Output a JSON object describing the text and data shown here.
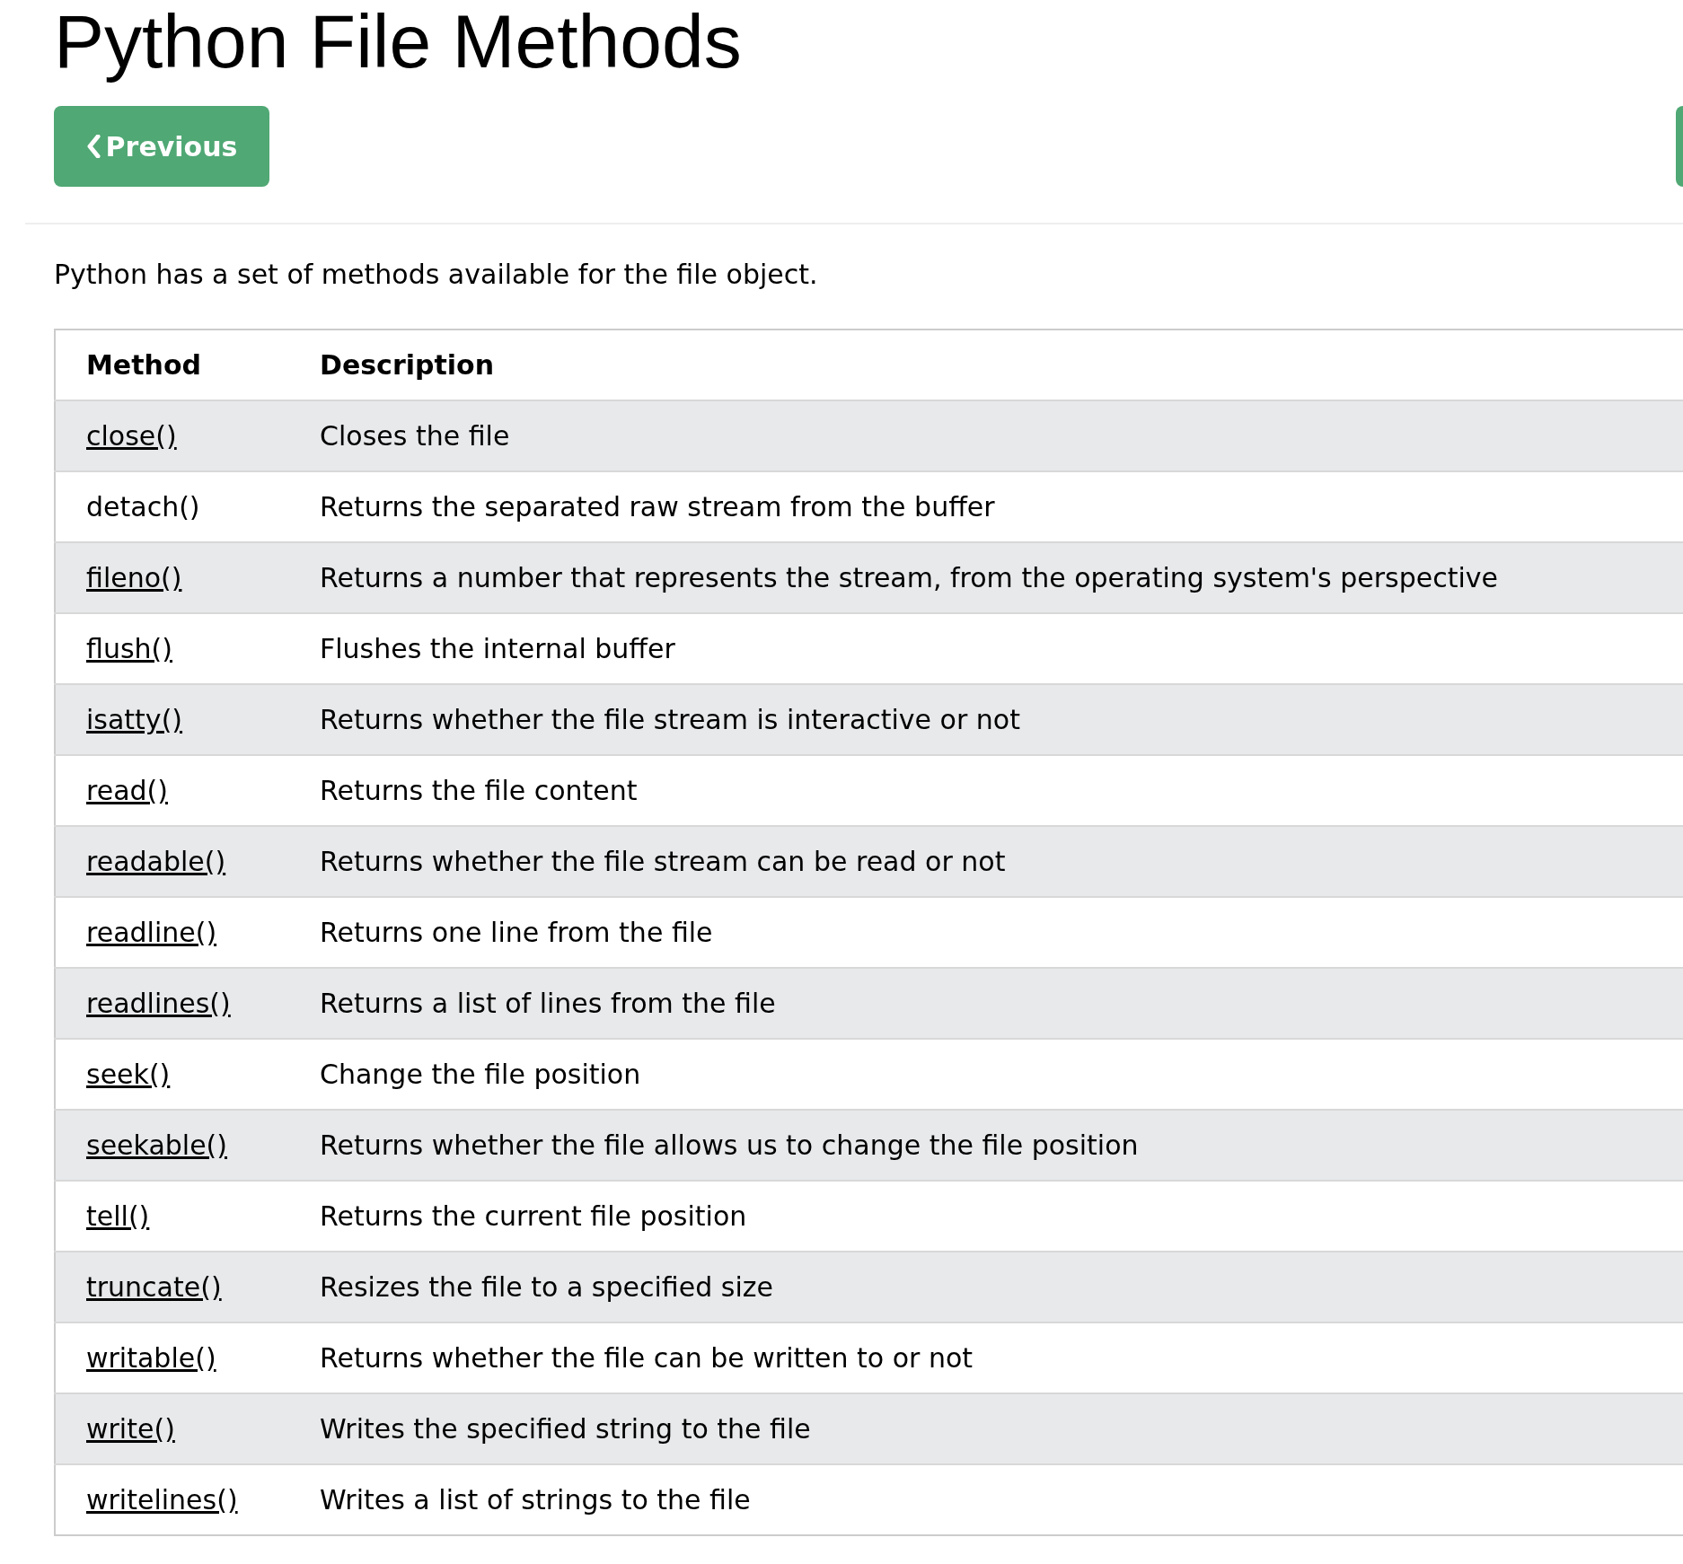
{
  "title": "Python File Methods",
  "nav": {
    "previous": "Previous"
  },
  "intro": "Python has a set of methods available for the file object.",
  "table": {
    "columns": [
      "Method",
      "Description"
    ],
    "rows": [
      {
        "method": "close()",
        "link": true,
        "description": "Closes the file"
      },
      {
        "method": "detach()",
        "link": false,
        "description": "Returns the separated raw stream from the buffer"
      },
      {
        "method": "fileno()",
        "link": true,
        "description": "Returns a number that represents the stream, from the operating system's perspective"
      },
      {
        "method": "flush()",
        "link": true,
        "description": "Flushes the internal buffer"
      },
      {
        "method": "isatty()",
        "link": true,
        "description": "Returns whether the file stream is interactive or not"
      },
      {
        "method": "read()",
        "link": true,
        "description": "Returns the file content"
      },
      {
        "method": "readable()",
        "link": true,
        "description": "Returns whether the file stream can be read or not"
      },
      {
        "method": "readline()",
        "link": true,
        "description": "Returns one line from the file"
      },
      {
        "method": "readlines()",
        "link": true,
        "description": "Returns a list of lines from the file"
      },
      {
        "method": "seek()",
        "link": true,
        "description": "Change the file position"
      },
      {
        "method": "seekable()",
        "link": true,
        "description": "Returns whether the file allows us to change the file position"
      },
      {
        "method": "tell()",
        "link": true,
        "description": "Returns the current file position"
      },
      {
        "method": "truncate()",
        "link": true,
        "description": "Resizes the file to a specified size"
      },
      {
        "method": "writable()",
        "link": true,
        "description": "Returns whether the file can be written to or not"
      },
      {
        "method": "write()",
        "link": true,
        "description": "Writes the specified string to the file"
      },
      {
        "method": "writelines()",
        "link": true,
        "description": "Writes a list of strings to the file"
      }
    ]
  }
}
